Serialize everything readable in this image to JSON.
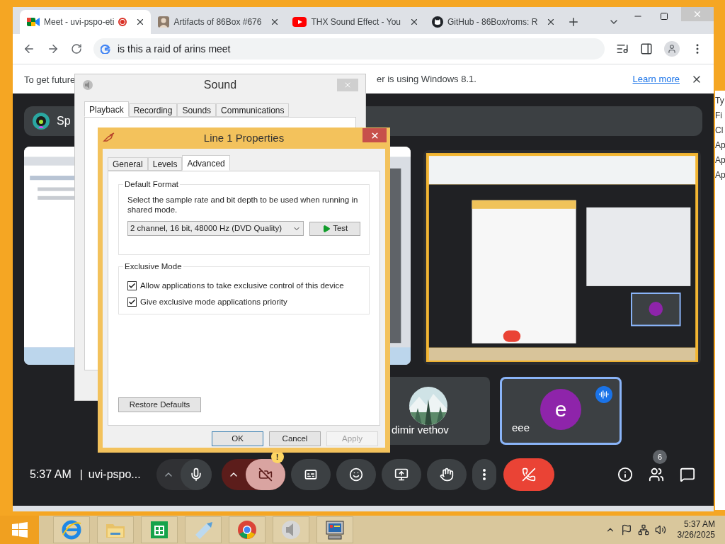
{
  "browser": {
    "tabs": [
      {
        "kind": "meet",
        "title": "Meet - uvi-pspo-eti",
        "selected": true,
        "recording": true
      },
      {
        "kind": "avatar",
        "title": "Artifacts of 86Box #676",
        "selected": false,
        "recording": false
      },
      {
        "kind": "video",
        "title": "THX Sound Effect - You",
        "selected": false,
        "recording": false
      },
      {
        "kind": "repo",
        "title": "GitHub - 86Box/roms: R",
        "selected": false,
        "recording": false
      }
    ],
    "address": "is this a raid of arins meet",
    "infobar": {
      "text_start": "To get future",
      "text_end": "er is using Windows 8.1.",
      "link": "Learn more"
    }
  },
  "meet": {
    "header": "Sp",
    "participants": [
      {
        "kind": "picture",
        "name": "dimir vethov",
        "selected": false,
        "speaking": false
      },
      {
        "kind": "initial",
        "name": "eee",
        "initial": "e",
        "selected": true,
        "speaking": true
      }
    ],
    "time": "5:37 AM",
    "separator": "|",
    "meeting_code": "uvi-pspo...",
    "mic_on": true,
    "camera_on": false,
    "camera_warning": "!",
    "people_count": "6"
  },
  "side_window": {
    "lines": [
      "Ty",
      "Fi",
      "Cl",
      "Ap",
      "Ap",
      "Ap"
    ]
  },
  "sound_dialog": {
    "title": "Sound",
    "tabs": [
      {
        "label": "Playback",
        "selected": true
      },
      {
        "label": "Recording",
        "selected": false
      },
      {
        "label": "Sounds",
        "selected": false
      },
      {
        "label": "Communications",
        "selected": false
      }
    ]
  },
  "properties_dialog": {
    "title": "Line 1 Properties",
    "tabs": [
      {
        "label": "General",
        "selected": false
      },
      {
        "label": "Levels",
        "selected": false
      },
      {
        "label": "Advanced",
        "selected": true
      }
    ],
    "default_format": {
      "title": "Default Format",
      "description": "Select the sample rate and bit depth to be used when running in shared mode.",
      "format": "2 channel, 16 bit, 48000 Hz (DVD Quality)",
      "test_button": "Test"
    },
    "exclusive_mode": {
      "title": "Exclusive Mode",
      "options": [
        {
          "label": "Allow applications to take exclusive control of this device",
          "checked": true
        },
        {
          "label": "Give exclusive mode applications priority",
          "checked": true
        }
      ]
    },
    "restore_button": "Restore Defaults",
    "buttons": [
      {
        "label": "OK",
        "disabled": false
      },
      {
        "label": "Cancel",
        "disabled": false
      },
      {
        "label": "Apply",
        "disabled": true
      }
    ]
  },
  "taskbar": {
    "apps": [
      {
        "kind": "ie"
      },
      {
        "kind": "folder"
      },
      {
        "kind": "store"
      },
      {
        "kind": "quill"
      },
      {
        "kind": "chrome"
      },
      {
        "kind": "speaker"
      },
      {
        "kind": "emulator"
      }
    ],
    "time": "5:37 AM",
    "date": "3/26/2025"
  }
}
